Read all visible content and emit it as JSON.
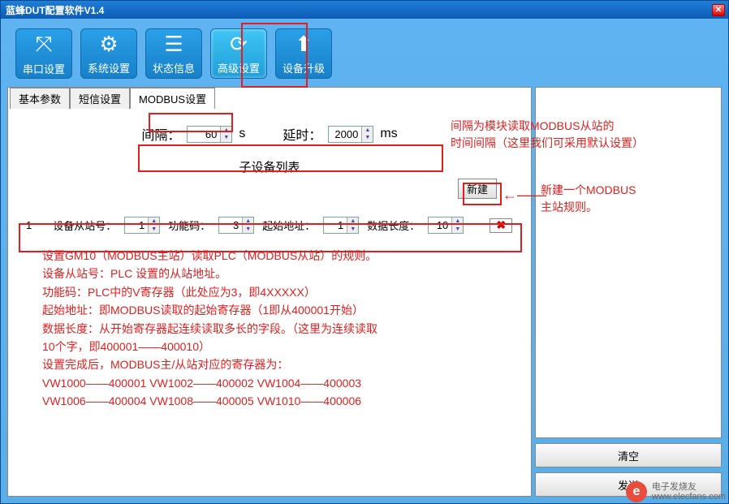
{
  "title": "蓝蜂DUT配置软件V1.4",
  "toolbar": {
    "items": [
      {
        "label": "串口设置",
        "icon": "⤧"
      },
      {
        "label": "系统设置",
        "icon": "⚙"
      },
      {
        "label": "状态信息",
        "icon": "☰"
      },
      {
        "label": "高级设置",
        "icon": "⟳",
        "active": true
      },
      {
        "label": "设备升级",
        "icon": "⬆"
      }
    ]
  },
  "tabs": {
    "items": [
      "基本参数",
      "短信设置",
      "MODBUS设置"
    ],
    "active": 2
  },
  "params": {
    "interval_label": "间隔：",
    "interval_val": "60",
    "interval_unit": "s",
    "delay_label": "延时：",
    "delay_val": "2000",
    "delay_unit": "ms"
  },
  "sub_title": "子设备列表",
  "btn_new": "新建",
  "device_row": {
    "idx": "1",
    "slave_label": "设备从站号：",
    "slave_val": "1",
    "func_label": "功能码：",
    "func_val": "3",
    "addr_label": "起始地址：",
    "addr_val": "1",
    "len_label": "数据长度：",
    "len_val": "10"
  },
  "annotations": {
    "a1": "间隔为模块读取MODBUS从站的",
    "a1b": "时间间隔（这里我们可采用默认设置）",
    "a2": "新建一个MODBUS",
    "a2b": "主站规则。"
  },
  "help": {
    "l1": "设置GM10（MODBUS主站）读取PLC（MODBUS从站）的规则。",
    "l2": "设备从站号：PLC 设置的从站地址。",
    "l3": "功能码：PLC中的V寄存器（此处应为3，即4XXXXX）",
    "l4": "起始地址：即MODBUS读取的起始寄存器（1即从400001开始）",
    "l5": "数据长度：从开始寄存器起连续读取多长的字段。（这里为连续读取",
    "l6": "10个字，即400001——400010）",
    "l7": "设置完成后，MODBUS主/从站对应的寄存器为：",
    "l8": "VW1000——400001   VW1002——400002   VW1004——400003",
    "l9": "VW1006——400004   VW1008——400005   VW1010——400006"
  },
  "right": {
    "btn_clear": "清空",
    "btn_send": "发送"
  },
  "watermark": {
    "brand": "电子发烧友",
    "url": "www.elecfans.com"
  }
}
